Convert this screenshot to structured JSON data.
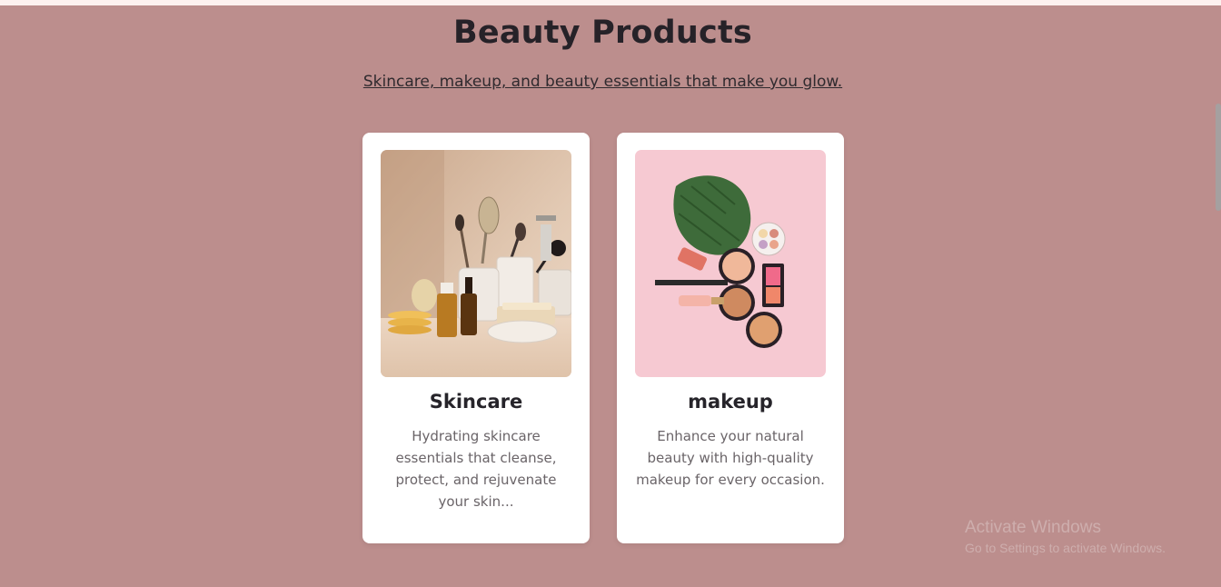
{
  "page": {
    "title": "Beauty Products",
    "subtitle": "Skincare, makeup, and beauty essentials that make you glow."
  },
  "cards": [
    {
      "title": "Skincare",
      "description": "Hydrating skincare essentials that cleanse, protect, and rejuvenate your skin...",
      "image": "skincare-products-photo"
    },
    {
      "title": "makeup",
      "description": "Enhance your natural beauty with high-quality makeup for every occasion.",
      "image": "makeup-products-photo"
    }
  ],
  "watermark": {
    "line1": "Activate Windows",
    "line2": "Go to Settings to activate Windows."
  },
  "colors": {
    "background": "#bc8e8d",
    "card": "#ffffff",
    "title": "#262228"
  }
}
